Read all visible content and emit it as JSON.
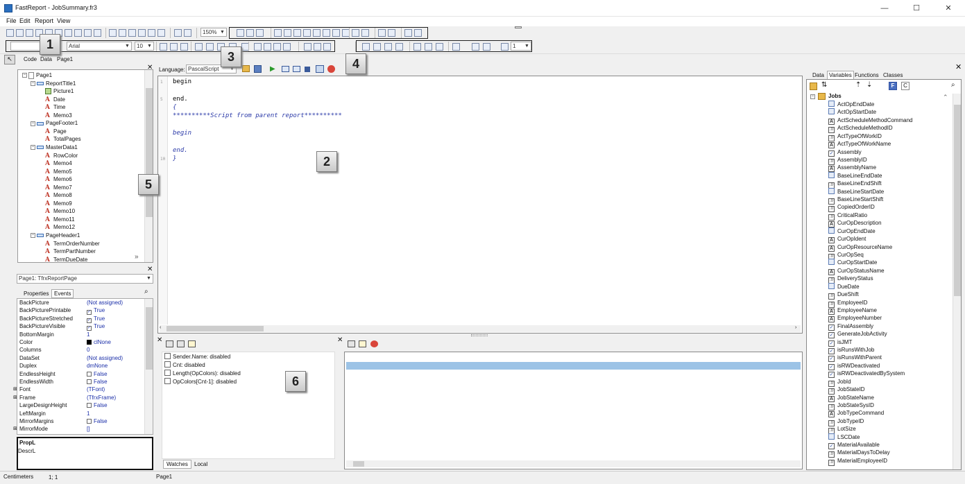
{
  "window": {
    "title": "FastReport - JobSummary.fr3",
    "minimize": "—",
    "maximize": "☐",
    "close": "✕"
  },
  "menu": [
    "File",
    "Edit",
    "Report",
    "View"
  ],
  "toolbar": {
    "zoom": "150%",
    "font": "Arial",
    "size": "10",
    "line_width": "1"
  },
  "callouts": [
    "1",
    "2",
    "3",
    "4",
    "5",
    "6"
  ],
  "design_tabs": [
    "Code",
    "Data",
    "Page1"
  ],
  "code_toolbar": {
    "language_label": "Language:",
    "language": "PascalScript"
  },
  "code_lines": [
    "begin",
    "",
    "end.",
    "{",
    "**********Script from parent report**********",
    "",
    "begin",
    "",
    "end.",
    "}"
  ],
  "line_numbers": [
    "1",
    "",
    "5",
    "",
    "",
    "",
    "",
    "",
    "",
    "10"
  ],
  "tree": [
    {
      "label": "Page1",
      "type": "page",
      "level": 0,
      "exp": "−"
    },
    {
      "label": "ReportTitle1",
      "type": "band",
      "level": 1,
      "exp": "−"
    },
    {
      "label": "Picture1",
      "type": "pic",
      "level": 2
    },
    {
      "label": "Date",
      "type": "a",
      "level": 2
    },
    {
      "label": "Time",
      "type": "a",
      "level": 2
    },
    {
      "label": "Memo3",
      "type": "a",
      "level": 2
    },
    {
      "label": "PageFooter1",
      "type": "band",
      "level": 1,
      "exp": "−"
    },
    {
      "label": "Page",
      "type": "a",
      "level": 2
    },
    {
      "label": "TotalPages",
      "type": "a",
      "level": 2
    },
    {
      "label": "MasterData1",
      "type": "band",
      "level": 1,
      "exp": "−"
    },
    {
      "label": "RowColor",
      "type": "a",
      "level": 2
    },
    {
      "label": "Memo4",
      "type": "a",
      "level": 2
    },
    {
      "label": "Memo5",
      "type": "a",
      "level": 2
    },
    {
      "label": "Memo6",
      "type": "a",
      "level": 2
    },
    {
      "label": "Memo7",
      "type": "a",
      "level": 2
    },
    {
      "label": "Memo8",
      "type": "a",
      "level": 2
    },
    {
      "label": "Memo9",
      "type": "a",
      "level": 2
    },
    {
      "label": "Memo10",
      "type": "a",
      "level": 2
    },
    {
      "label": "Memo11",
      "type": "a",
      "level": 2
    },
    {
      "label": "Memo12",
      "type": "a",
      "level": 2
    },
    {
      "label": "PageHeader1",
      "type": "band",
      "level": 1,
      "exp": "−"
    },
    {
      "label": "TermOrderNumber",
      "type": "a",
      "level": 2
    },
    {
      "label": "TermPartNumber",
      "type": "a",
      "level": 2
    },
    {
      "label": "TermDueDate",
      "type": "a",
      "level": 2
    }
  ],
  "inspector": {
    "object": "Page1: TfrxReportPage",
    "tabs": [
      "Properties",
      "Events"
    ],
    "desc_title": "PropL",
    "desc_text": "DescrL"
  },
  "properties": [
    {
      "name": "BackPicture",
      "value": "(Not assigned)"
    },
    {
      "name": "BackPicturePrintable",
      "value": "True",
      "check": "✓"
    },
    {
      "name": "BackPictureStretched",
      "value": "True",
      "check": "✓"
    },
    {
      "name": "BackPictureVisible",
      "value": "True",
      "check": "✓"
    },
    {
      "name": "BottomMargin",
      "value": "1"
    },
    {
      "name": "Color",
      "value": "clNone",
      "swatch": "#000000"
    },
    {
      "name": "Columns",
      "value": "0"
    },
    {
      "name": "DataSet",
      "value": "(Not assigned)"
    },
    {
      "name": "Duplex",
      "value": "dmNone"
    },
    {
      "name": "EndlessHeight",
      "value": "False",
      "check": ""
    },
    {
      "name": "EndlessWidth",
      "value": "False",
      "check": ""
    },
    {
      "name": "Font",
      "value": "(TFont)",
      "plus": "+"
    },
    {
      "name": "Frame",
      "value": "(TfrxFrame)",
      "plus": "+"
    },
    {
      "name": "LargeDesignHeight",
      "value": "False",
      "check": ""
    },
    {
      "name": "LeftMargin",
      "value": "1"
    },
    {
      "name": "MirrorMargins",
      "value": "False",
      "check": ""
    },
    {
      "name": "MirrorMode",
      "value": "[]",
      "plus": "+"
    }
  ],
  "watches": [
    "Sender.Name: disabled",
    "Cnt: disabled",
    "Length(OpColors): disabled",
    "OpColors[Cnt-1]: disabled"
  ],
  "watch_tabs": [
    "Watches",
    "Local"
  ],
  "right_tabs": [
    "Data",
    "Variables",
    "Functions",
    "Classes"
  ],
  "data_root": "Jobs",
  "fields": [
    {
      "n": "ActOpEndDate",
      "t": "t"
    },
    {
      "n": "ActOpStartDate",
      "t": "t"
    },
    {
      "n": "ActScheduleMethodCommand",
      "t": "A"
    },
    {
      "n": "ActScheduleMethodID",
      "t": "0"
    },
    {
      "n": "ActTypeOfWorkID",
      "t": "0"
    },
    {
      "n": "ActTypeOfWorkName",
      "t": "A"
    },
    {
      "n": "Assembly",
      "t": "✓"
    },
    {
      "n": "AssemblyID",
      "t": "0"
    },
    {
      "n": "AssemblyName",
      "t": "A"
    },
    {
      "n": "BaseLineEndDate",
      "t": "t"
    },
    {
      "n": "BaseLineEndShift",
      "t": "0"
    },
    {
      "n": "BaseLineStartDate",
      "t": "t"
    },
    {
      "n": "BaseLineStartShift",
      "t": "0"
    },
    {
      "n": "CopiedOrderID",
      "t": "0"
    },
    {
      "n": "CriticalRatio",
      "t": "0"
    },
    {
      "n": "CurOpDescription",
      "t": "A"
    },
    {
      "n": "CurOpEndDate",
      "t": "t"
    },
    {
      "n": "CurOpIdent",
      "t": "A"
    },
    {
      "n": "CurOpResourceName",
      "t": "A"
    },
    {
      "n": "CurOpSeq",
      "t": "0"
    },
    {
      "n": "CurOpStartDate",
      "t": "t"
    },
    {
      "n": "CurOpStatusName",
      "t": "A"
    },
    {
      "n": "DeliveryStatus",
      "t": "0"
    },
    {
      "n": "DueDate",
      "t": "t"
    },
    {
      "n": "DueShift",
      "t": "0"
    },
    {
      "n": "EmployeeID",
      "t": "0"
    },
    {
      "n": "EmployeeName",
      "t": "A"
    },
    {
      "n": "EmployeeNumber",
      "t": "A"
    },
    {
      "n": "FinalAssembly",
      "t": "✓"
    },
    {
      "n": "GenerateJobActivity",
      "t": "✓"
    },
    {
      "n": "isJMT",
      "t": "✓"
    },
    {
      "n": "isRunsWithJob",
      "t": "✓"
    },
    {
      "n": "isRunsWithParent",
      "t": "✓"
    },
    {
      "n": "isRWDeactivated",
      "t": "✓"
    },
    {
      "n": "isRWDeactivatedBySystem",
      "t": "✓"
    },
    {
      "n": "JobId",
      "t": "0"
    },
    {
      "n": "JobStateID",
      "t": "0"
    },
    {
      "n": "JobStateName",
      "t": "A"
    },
    {
      "n": "JobStateSysID",
      "t": "0"
    },
    {
      "n": "JobTypeCommand",
      "t": "A"
    },
    {
      "n": "JobTypeID",
      "t": "0"
    },
    {
      "n": "LotSize",
      "t": "0"
    },
    {
      "n": "LSCDate",
      "t": "t"
    },
    {
      "n": "MaterialAvailable",
      "t": "✓"
    },
    {
      "n": "MaterialDaysToDelay",
      "t": "0"
    },
    {
      "n": "MaterialEmployeeID",
      "t": "0"
    }
  ],
  "status": {
    "units": "Centimeters",
    "pos": "1; 1",
    "page": "Page1"
  }
}
